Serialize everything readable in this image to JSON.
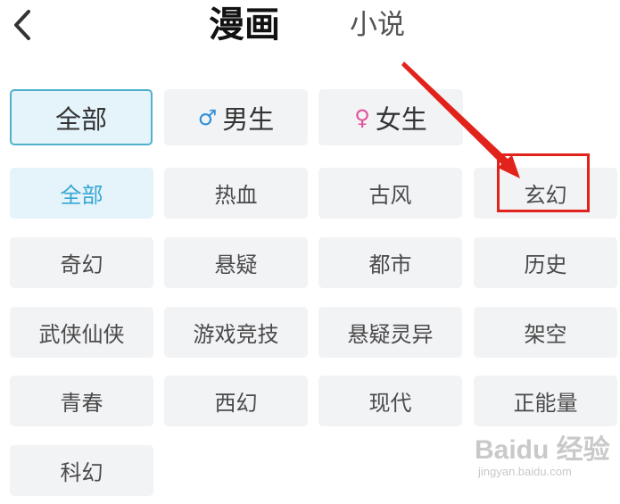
{
  "header": {
    "back_icon": "chevron-left-icon",
    "tab_comic": "漫画",
    "tab_novel": "小说"
  },
  "gender_filter": [
    {
      "label": "全部",
      "icon": "",
      "active": true
    },
    {
      "label": "男生",
      "icon": "male-symbol-icon",
      "active": false
    },
    {
      "label": "女生",
      "icon": "female-symbol-icon",
      "active": false
    }
  ],
  "categories": [
    {
      "label": "全部",
      "active": true
    },
    {
      "label": "热血"
    },
    {
      "label": "古风"
    },
    {
      "label": "玄幻",
      "highlighted": true
    },
    {
      "label": "奇幻"
    },
    {
      "label": "悬疑"
    },
    {
      "label": "都市"
    },
    {
      "label": "历史"
    },
    {
      "label": "武侠仙侠"
    },
    {
      "label": "游戏竞技"
    },
    {
      "label": "悬疑灵异"
    },
    {
      "label": "架空"
    },
    {
      "label": "青春"
    },
    {
      "label": "西幻"
    },
    {
      "label": "现代"
    },
    {
      "label": "正能量"
    },
    {
      "label": "科幻"
    }
  ],
  "colors": {
    "accent": "#35a7d3",
    "active_bg": "#e5f3fb",
    "button_bg": "#f2f3f5",
    "male": "#2f8fd8",
    "female": "#e0519a",
    "annotation": "#e1231b"
  },
  "watermark": {
    "brand": "Baidu 经验",
    "url": "jingyan.baidu.com"
  }
}
